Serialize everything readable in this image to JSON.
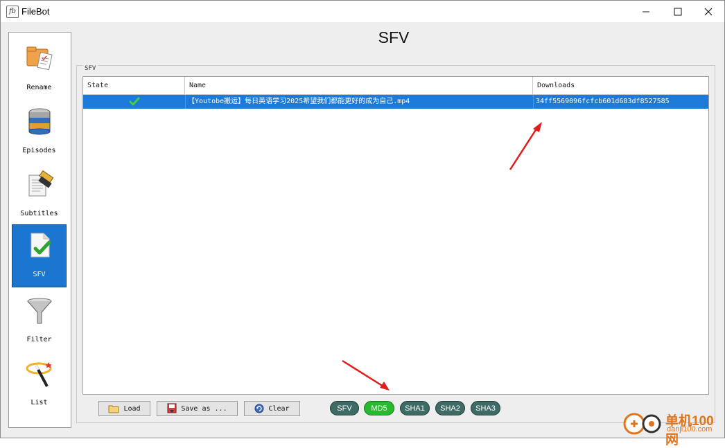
{
  "window": {
    "title": "FileBot",
    "app_icon_text": "fb"
  },
  "sidebar": {
    "items": [
      {
        "label": "Rename",
        "icon": "rename-icon"
      },
      {
        "label": "Episodes",
        "icon": "database-icon"
      },
      {
        "label": "Subtitles",
        "icon": "subtitles-icon"
      },
      {
        "label": "SFV",
        "icon": "sfv-check-icon",
        "active": true
      },
      {
        "label": "Filter",
        "icon": "funnel-icon"
      },
      {
        "label": "List",
        "icon": "magic-wand-icon"
      }
    ]
  },
  "header": {
    "title": "SFV"
  },
  "panel": {
    "legend": "SFV"
  },
  "table": {
    "columns": [
      "State",
      "Name",
      "Downloads"
    ],
    "rows": [
      {
        "state": "ok",
        "state_icon": "checkmark-icon",
        "name": "【Youtobe搬运】每日英语学习2025希望我们都能更好的成为自己.mp4",
        "download": "34ff5569096fcfcb601d683df8527585"
      }
    ]
  },
  "buttons": {
    "load": "Load",
    "save_as": "Save as ...",
    "clear": "Clear"
  },
  "hash_types": [
    "SFV",
    "MD5",
    "SHA1",
    "SHA2",
    "SHA3"
  ],
  "selected_hash": "MD5",
  "watermark": {
    "text": "单机100网",
    "url": "danji100.com"
  },
  "colors": {
    "accent": "#1e7ad8",
    "selected_hash": "#27b92e",
    "hash_button": "#3f6b66",
    "arrow": "#e21b1b"
  }
}
